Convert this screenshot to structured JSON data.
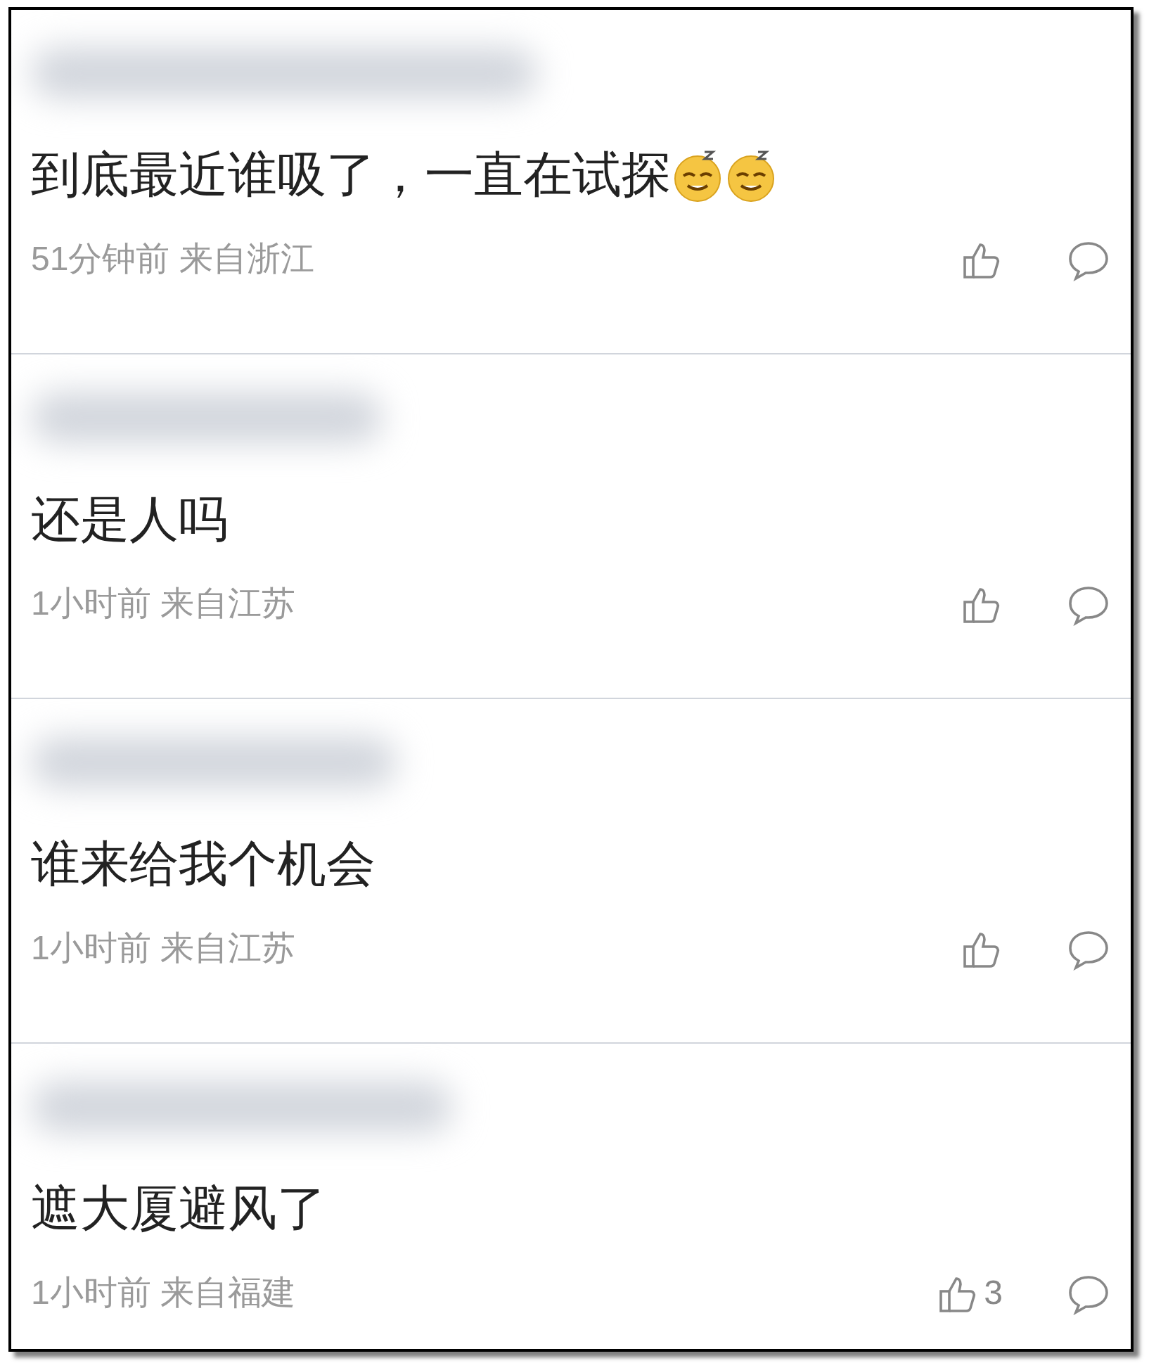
{
  "comments": [
    {
      "content": "到底最近谁吸了，一直在试探",
      "emojis": [
        {
          "kind": "sleepy"
        },
        {
          "kind": "sleepy"
        }
      ],
      "meta": "51分钟前 来自浙江"
    },
    {
      "content": "还是人吗",
      "meta": "1小时前 来自江苏"
    },
    {
      "content": "谁来给我个机会",
      "meta": "1小时前 来自江苏"
    },
    {
      "content": "遮大厦避风了",
      "meta": "1小时前 来自福建",
      "like_count": "3"
    }
  ]
}
